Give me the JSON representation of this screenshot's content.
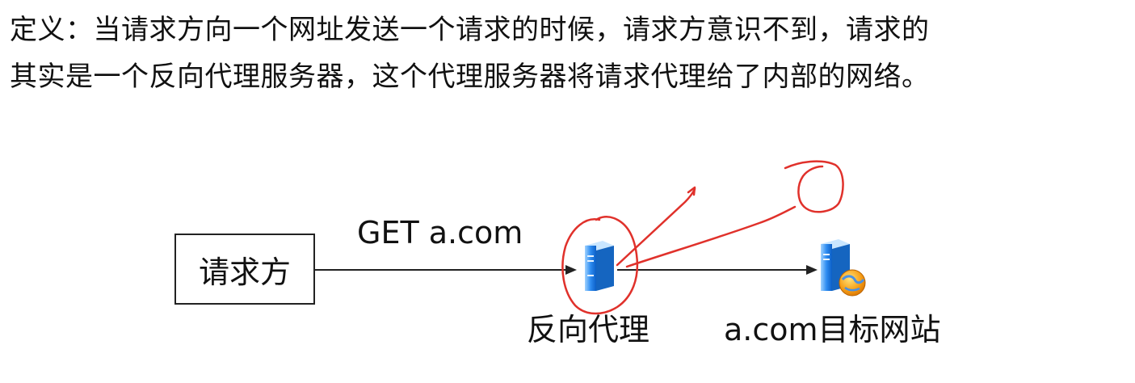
{
  "definition": {
    "line1": "定义：当请求方向一个网址发送一个请求的时候，请求方意识不到，请求的",
    "line2": "其实是一个反向代理服务器，这个代理服务器将请求代理给了内部的网络。"
  },
  "diagram": {
    "client_label": "请求方",
    "request_label": "GET a.com",
    "proxy_label": "反向代理",
    "target_label": "a.com目标网站",
    "annotation_color": "#e0312b",
    "server_icon": "server-icon",
    "web_server_icon": "web-server-globe-icon"
  }
}
